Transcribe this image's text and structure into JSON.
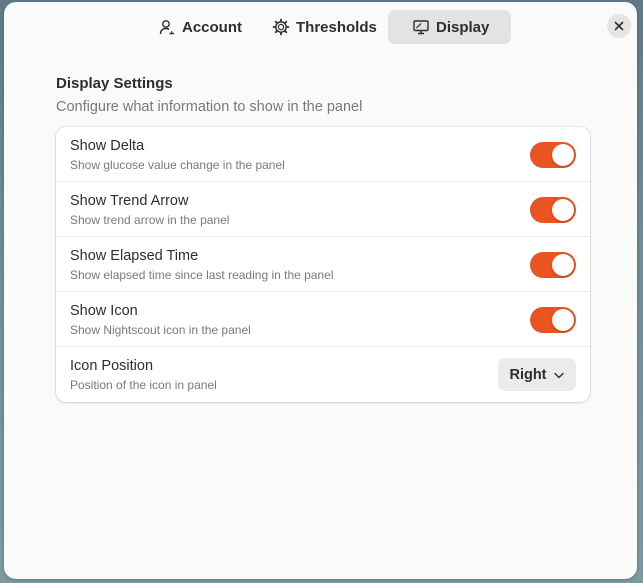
{
  "tabs": [
    {
      "label": "Account",
      "icon": "person-icon",
      "active": false
    },
    {
      "label": "Thresholds",
      "icon": "gear-icon",
      "active": false
    },
    {
      "label": "Display",
      "icon": "monitor-icon",
      "active": true
    }
  ],
  "close_icon": "close-icon",
  "section": {
    "title": "Display Settings",
    "subtitle": "Configure what information to show in the panel"
  },
  "rows": [
    {
      "title": "Show Delta",
      "subtitle": "Show glucose value change in the panel",
      "type": "switch",
      "on": true
    },
    {
      "title": "Show Trend Arrow",
      "subtitle": "Show trend arrow in the panel",
      "type": "switch",
      "on": true
    },
    {
      "title": "Show Elapsed Time",
      "subtitle": "Show elapsed time since last reading in the panel",
      "type": "switch",
      "on": true
    },
    {
      "title": "Show Icon",
      "subtitle": "Show Nightscout icon in the panel",
      "type": "switch",
      "on": true
    },
    {
      "title": "Icon Position",
      "subtitle": "Position of the icon in panel",
      "type": "dropdown",
      "value": "Right"
    }
  ],
  "colors": {
    "accent": "#e95420",
    "window_bg": "#fafafa",
    "active_tab_bg": "#e3e3e3"
  }
}
